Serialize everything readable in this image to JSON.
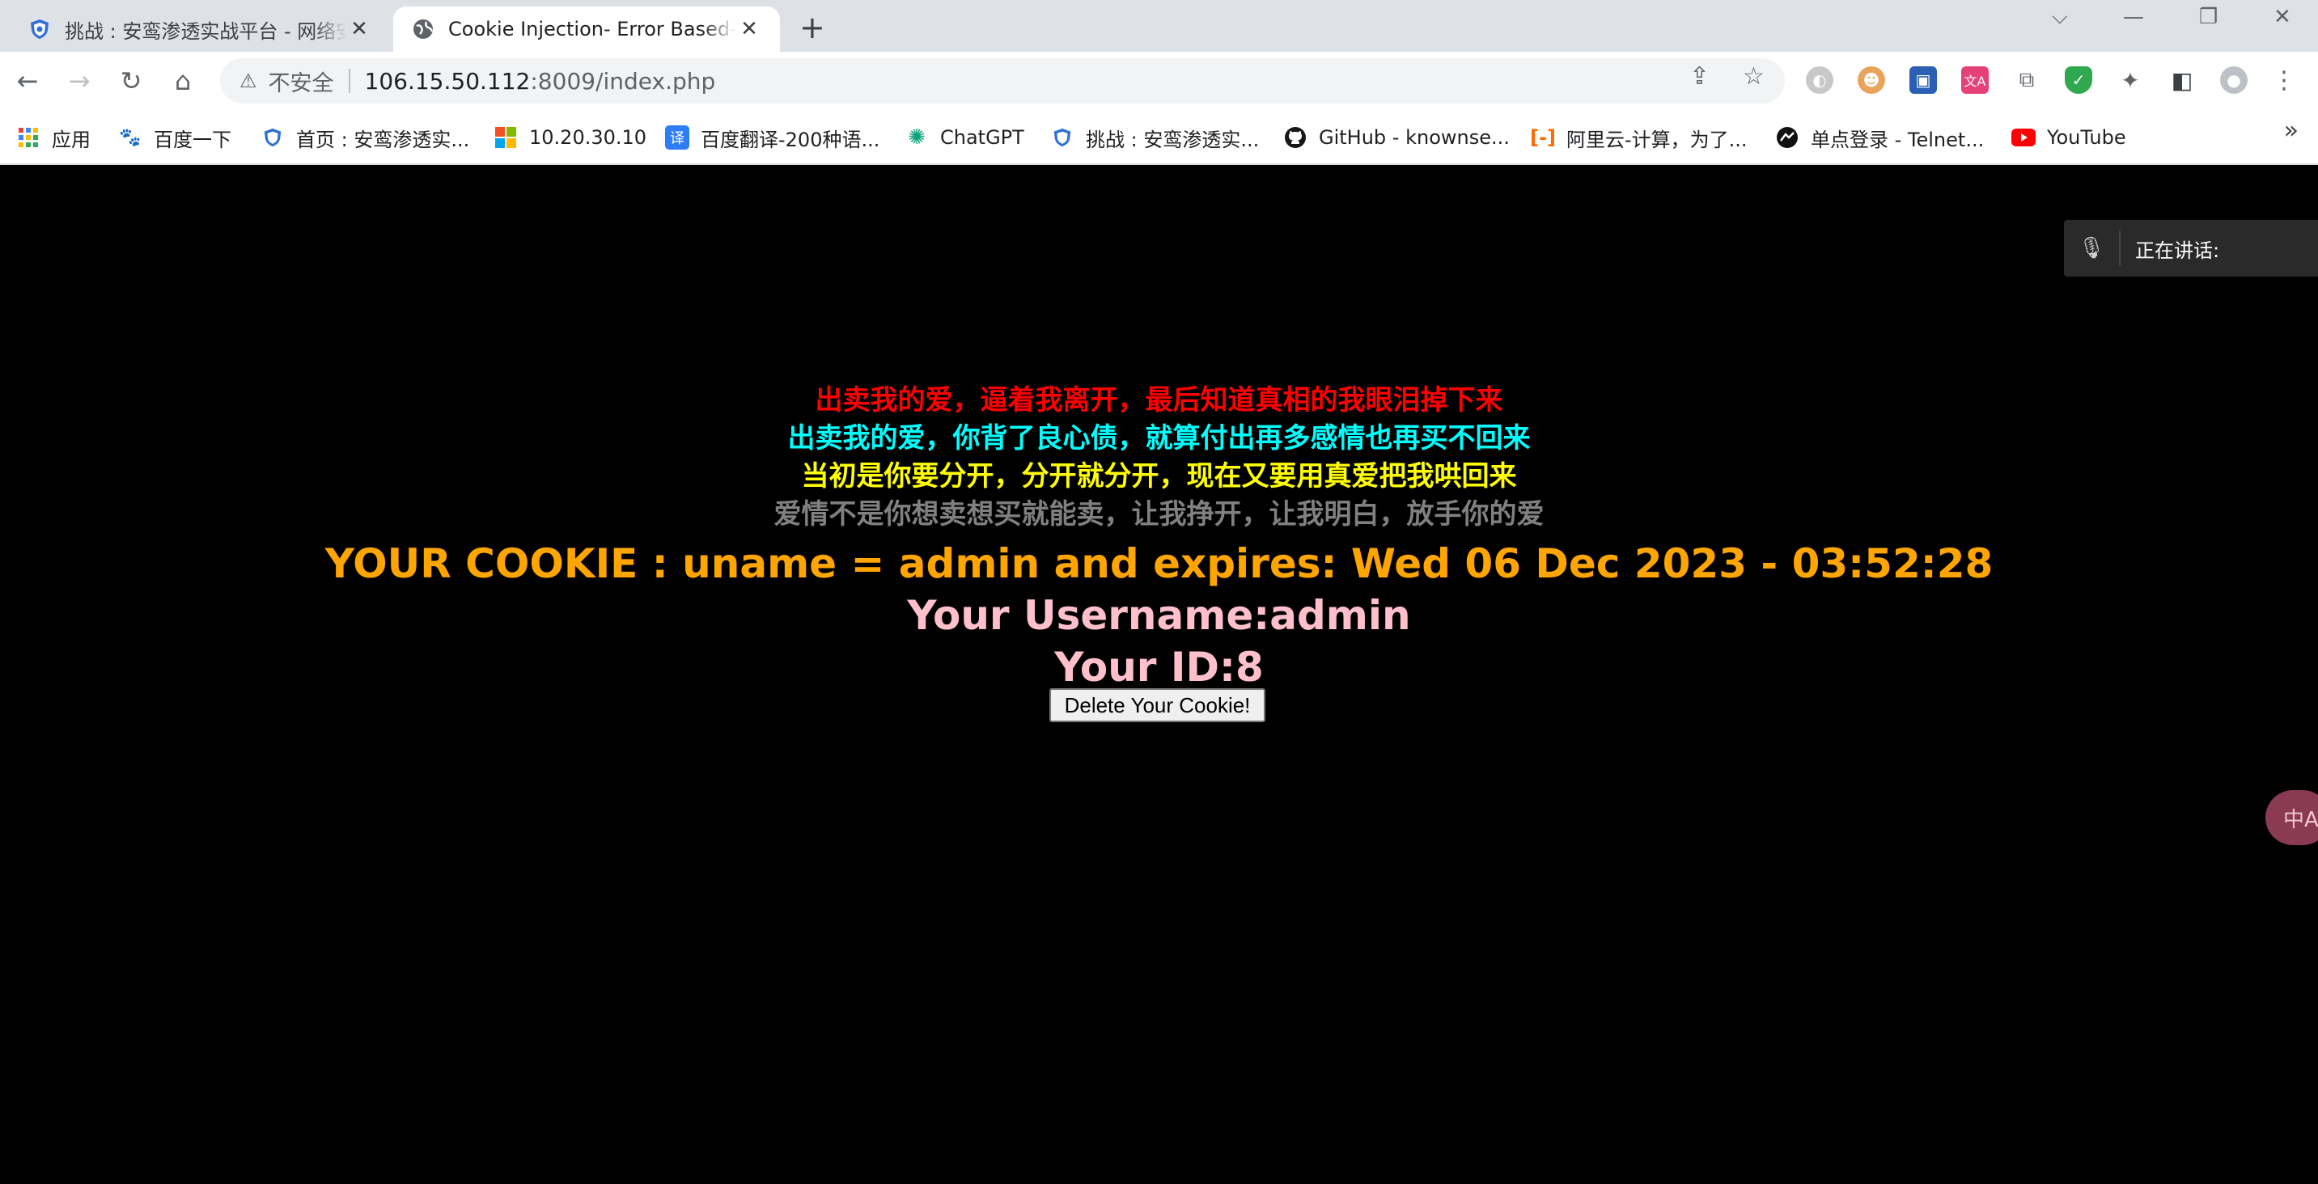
{
  "browser": {
    "tabs": [
      {
        "title": "挑战 : 安鸾渗透实战平台 - 网络安全",
        "favicon": "shield-icon"
      },
      {
        "title": "Cookie Injection- Error Based- s",
        "favicon": "globe-icon"
      }
    ],
    "new_tab_label": "+",
    "url": {
      "insecure_label": "不安全",
      "host": "106.15.50.112",
      "path": ":8009/index.php"
    },
    "bookmarks": [
      {
        "label": "应用",
        "icon": "apps-grid-icon"
      },
      {
        "label": "百度一下",
        "icon": "baidu-paw-icon"
      },
      {
        "label": "首页 : 安鸾渗透实...",
        "icon": "shield-icon"
      },
      {
        "label": "10.20.30.10",
        "icon": "windows-logo-icon"
      },
      {
        "label": "百度翻译-200种语...",
        "icon": "translate-icon"
      },
      {
        "label": "ChatGPT",
        "icon": "openai-icon"
      },
      {
        "label": "挑战 : 安鸾渗透实...",
        "icon": "shield-icon"
      },
      {
        "label": "GitHub - knownse...",
        "icon": "github-icon"
      },
      {
        "label": "阿里云-计算，为了...",
        "icon": "aliyun-icon"
      },
      {
        "label": "单点登录 - Telnet...",
        "icon": "telnet-icon"
      },
      {
        "label": "YouTube",
        "icon": "youtube-icon"
      }
    ],
    "bookmarks_more": "»"
  },
  "page": {
    "lyrics": [
      {
        "text": "出卖我的爱，逼着我离开，最后知道真相的我眼泪掉下来",
        "color": "#ff0000"
      },
      {
        "text": "出卖我的爱，你背了良心债，就算付出再多感情也再买不回来",
        "color": "#00ffff"
      },
      {
        "text": "当初是你要分开，分开就分开，现在又要用真爱把我哄回来",
        "color": "#ffff00"
      },
      {
        "text": "爱情不是你想卖想买就能卖，让我挣开，让我明白，放手你的爱",
        "color": "#808080"
      }
    ],
    "cookie_line": "YOUR COOKIE : uname = admin and expires: Wed 06 Dec 2023 - 03:52:28",
    "username_line": "Your Username:admin",
    "id_line": "Your ID:8",
    "delete_button": "Delete Your Cookie!",
    "cookie_color": "#ffa500",
    "info_color": "#ffc0cb"
  },
  "overlay": {
    "speaking_label": "正在讲话:",
    "translate_label": "中A"
  }
}
